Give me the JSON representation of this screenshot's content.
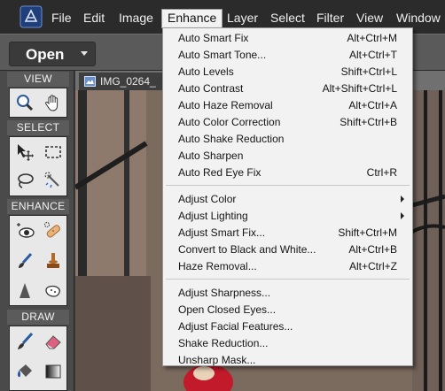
{
  "menubar": {
    "items": [
      "File",
      "Edit",
      "Image",
      "Enhance",
      "Layer",
      "Select",
      "Filter",
      "View",
      "Window"
    ]
  },
  "toolbar": {
    "open_label": "Open"
  },
  "tools": {
    "sections": [
      "VIEW",
      "SELECT",
      "ENHANCE",
      "DRAW"
    ]
  },
  "document": {
    "tab_title": "IMG_0264_"
  },
  "enhance_menu": {
    "groups": [
      [
        {
          "label": "Auto Smart Fix",
          "shortcut": "Alt+Ctrl+M"
        },
        {
          "label": "Auto Smart Tone...",
          "shortcut": "Alt+Ctrl+T"
        },
        {
          "label": "Auto Levels",
          "shortcut": "Shift+Ctrl+L"
        },
        {
          "label": "Auto Contrast",
          "shortcut": "Alt+Shift+Ctrl+L"
        },
        {
          "label": "Auto Haze Removal",
          "shortcut": "Alt+Ctrl+A"
        },
        {
          "label": "Auto Color Correction",
          "shortcut": "Shift+Ctrl+B"
        },
        {
          "label": "Auto Shake Reduction",
          "shortcut": ""
        },
        {
          "label": "Auto Sharpen",
          "shortcut": ""
        },
        {
          "label": "Auto Red Eye Fix",
          "shortcut": "Ctrl+R"
        }
      ],
      [
        {
          "label": "Adjust Color",
          "shortcut": "",
          "submenu": true
        },
        {
          "label": "Adjust Lighting",
          "shortcut": "",
          "submenu": true
        },
        {
          "label": "Adjust Smart Fix...",
          "shortcut": "Shift+Ctrl+M"
        },
        {
          "label": "Convert to Black and White...",
          "shortcut": "Alt+Ctrl+B"
        },
        {
          "label": "Haze Removal...",
          "shortcut": "Alt+Ctrl+Z"
        }
      ],
      [
        {
          "label": "Adjust Sharpness...",
          "shortcut": ""
        },
        {
          "label": "Open Closed Eyes...",
          "shortcut": ""
        },
        {
          "label": "Adjust Facial Features...",
          "shortcut": ""
        },
        {
          "label": "Shake Reduction...",
          "shortcut": ""
        },
        {
          "label": "Unsharp Mask...",
          "shortcut": ""
        }
      ]
    ]
  },
  "colors": {
    "menubar_bg": "#2b2b2b",
    "panel_bg": "#4a4a4a",
    "menu_bg": "#f2f2f2",
    "logo_blue": "#1e4a8c"
  }
}
